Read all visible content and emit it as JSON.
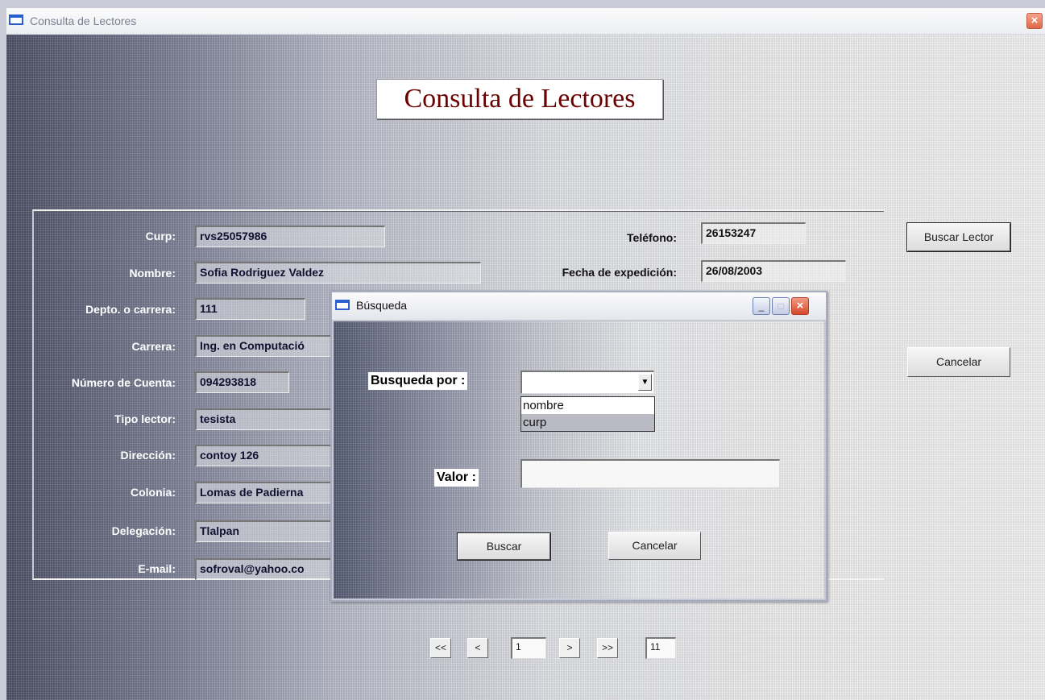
{
  "window": {
    "title": "Consulta de Lectores"
  },
  "heading": "Consulta de Lectores",
  "form": {
    "curp": {
      "label": "Curp:",
      "value": "rvs25057986"
    },
    "nombre": {
      "label": "Nombre:",
      "value": "Sofia Rodriguez Valdez"
    },
    "depto": {
      "label": "Depto. o carrera:",
      "value": "111"
    },
    "carrera": {
      "label": "Carrera:",
      "value": "Ing. en Computació"
    },
    "numero_cuenta": {
      "label": "Número de Cuenta:",
      "value": "094293818"
    },
    "tipo_lector": {
      "label": "Tipo lector:",
      "value": "tesista"
    },
    "direccion": {
      "label": "Dirección:",
      "value": "contoy 126"
    },
    "colonia": {
      "label": "Colonia:",
      "value": "Lomas de Padierna"
    },
    "delegacion": {
      "label": "Delegación:",
      "value": "Tlalpan"
    },
    "email": {
      "label": "E-mail:",
      "value": "sofroval@yahoo.co"
    },
    "telefono": {
      "label": "Teléfono:",
      "value": "26153247"
    },
    "fecha_expedicion": {
      "label": "Fecha de expedición:",
      "value": "26/08/2003"
    }
  },
  "buttons": {
    "buscar_lector": "Buscar Lector",
    "cancelar": "Cancelar"
  },
  "navigation": {
    "first": "<<",
    "prev": "<",
    "current": "1",
    "next": ">",
    "last": ">>",
    "total": "11"
  },
  "dialog": {
    "title": "Búsqueda",
    "busqueda_por_label": "Busqueda por :",
    "combo_value": "",
    "options": [
      "nombre",
      "curp"
    ],
    "selected_option": "curp",
    "valor_label": "Valor :",
    "valor_value": "",
    "buscar_label": "Buscar",
    "cancelar_label": "Cancelar"
  }
}
